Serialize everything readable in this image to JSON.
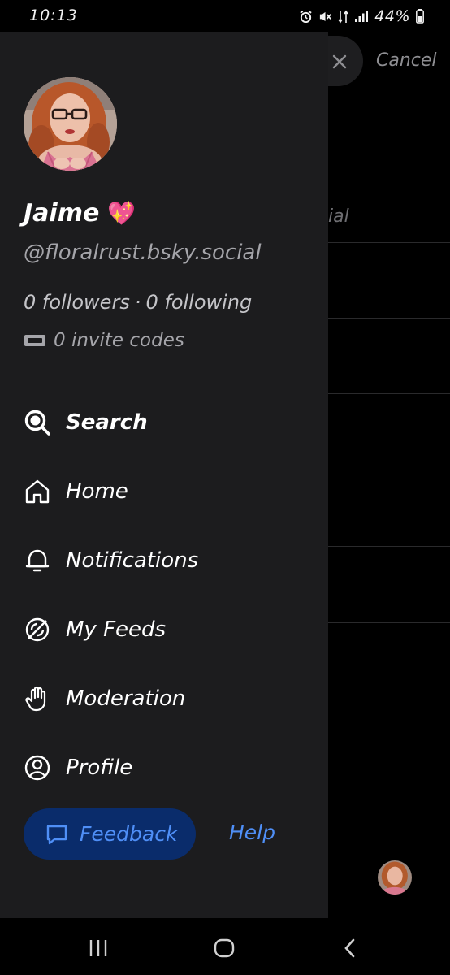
{
  "status_bar": {
    "time": "10:13",
    "battery": "44%",
    "icons": [
      "alarm-icon",
      "mute-icon",
      "data-transfer-icon",
      "signal-icon",
      "battery-icon"
    ]
  },
  "background": {
    "cancel_label": "Cancel",
    "partial_text": "ial"
  },
  "drawer": {
    "display_name": "Jaime",
    "name_emoji": "💖",
    "handle": "@floralrust.bsky.social",
    "followers": "0 followers",
    "separator": "·",
    "following": "0 following",
    "invite_codes": "0 invite codes",
    "nav": [
      {
        "label": "Search",
        "icon": "search-icon",
        "active": true
      },
      {
        "label": "Home",
        "icon": "home-icon"
      },
      {
        "label": "Notifications",
        "icon": "bell-icon"
      },
      {
        "label": "My Feeds",
        "icon": "feeds-icon"
      },
      {
        "label": "Moderation",
        "icon": "hand-icon"
      },
      {
        "label": "Profile",
        "icon": "profile-icon"
      }
    ],
    "feedback_label": "Feedback",
    "help_label": "Help"
  },
  "colors": {
    "drawer_bg": "#1c1c1e",
    "accent": "#4f8ff7",
    "feedback_bg": "#0a2c6b",
    "secondary_text": "#a5a5aa"
  }
}
